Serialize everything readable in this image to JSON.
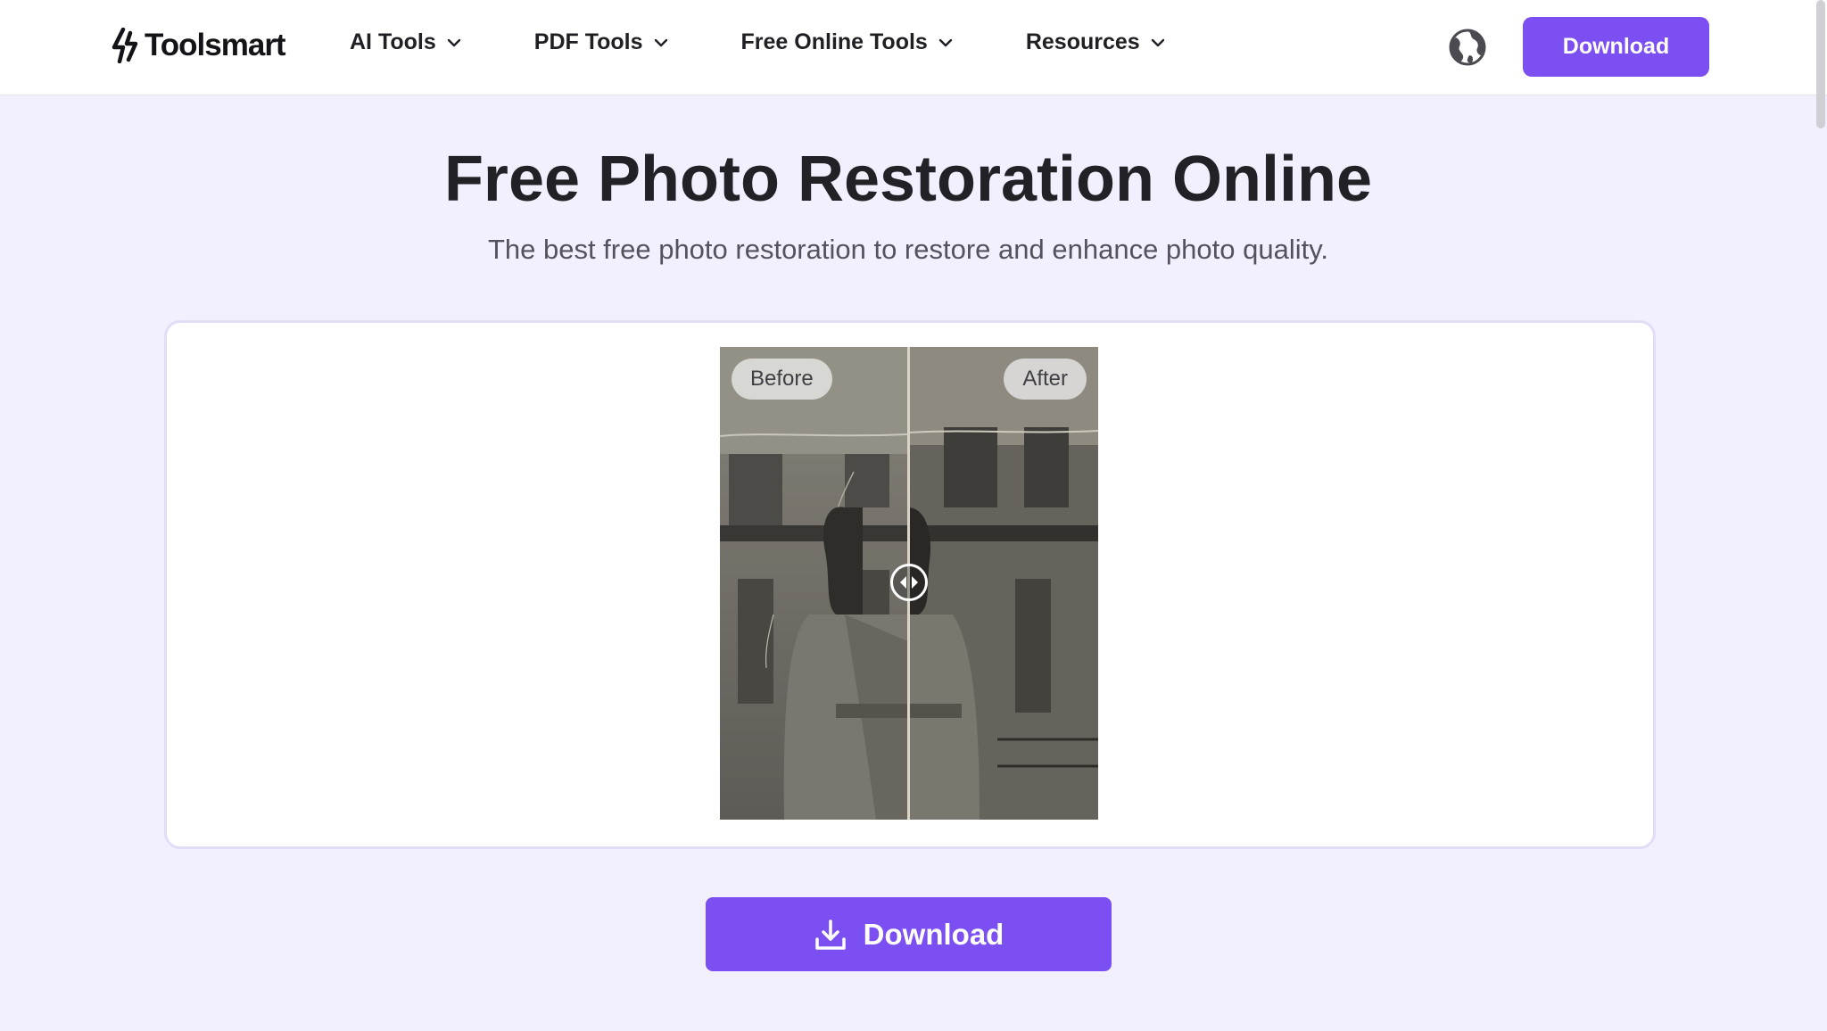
{
  "brand": {
    "name": "Toolsmart"
  },
  "nav": {
    "items": [
      {
        "label": "AI Tools"
      },
      {
        "label": "PDF Tools"
      },
      {
        "label": "Free Online Tools"
      },
      {
        "label": "Resources"
      }
    ]
  },
  "header": {
    "download_label": "Download"
  },
  "hero": {
    "title": "Free Photo Restoration Online",
    "subtitle": "The best free photo restoration to restore and enhance photo quality."
  },
  "comparison": {
    "before_label": "Before",
    "after_label": "After",
    "slider_position": 0.5
  },
  "main": {
    "download_label": "Download"
  },
  "colors": {
    "accent": "#7b4ff2",
    "page_bg": "#f2efff",
    "card_border": "#e3dcf7"
  },
  "icons": {
    "logo": "bolt-logo-icon",
    "nav_chevron": "chevron-down-icon",
    "language": "globe-icon",
    "slider": "compare-handle-icon",
    "download": "download-icon"
  }
}
